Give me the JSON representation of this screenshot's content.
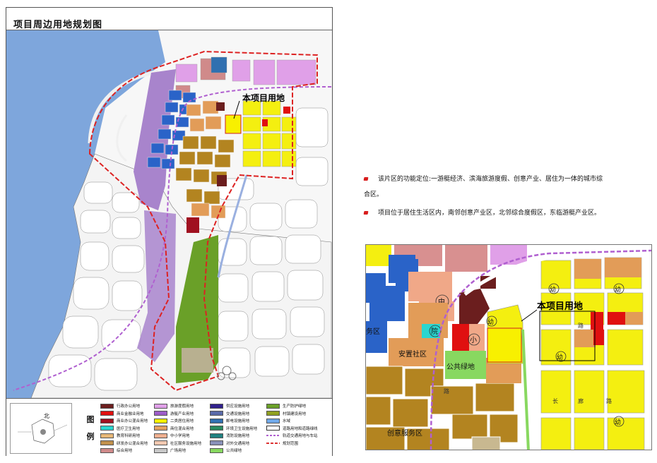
{
  "map_title": "项目周边用地规划图",
  "main_map": {
    "callout": "本项目用地"
  },
  "legend": {
    "heading_chars": [
      "图",
      "例"
    ],
    "north": "北",
    "columns": [
      [
        {
          "label": "行政办公用地",
          "color": "#6b1e1e"
        },
        {
          "label": "商业金融业用地",
          "color": "#e01010"
        },
        {
          "label": "商业办公混合用地",
          "color": "#a01020"
        },
        {
          "label": "医疗卫生用地",
          "color": "#2ad6d0"
        },
        {
          "label": "教育科研用地",
          "color": "#e8b878"
        },
        {
          "label": "研发办公混合用地",
          "color": "#c0904c"
        },
        {
          "label": "综合用地",
          "color": "#d08a8a"
        }
      ],
      [
        {
          "label": "旅游度假用地",
          "color": "#e0a0e8"
        },
        {
          "label": "游艇产业用地",
          "color": "#9c5cc8"
        },
        {
          "label": "二类居住用地",
          "color": "#f4f000"
        },
        {
          "label": "商住混合用地",
          "color": "#e2a060"
        },
        {
          "label": "中小学用地",
          "color": "#f0b090"
        },
        {
          "label": "社区服务设施用地",
          "color": "#f2c8b0"
        },
        {
          "label": "广场用地",
          "color": "#c8c8c8"
        }
      ],
      [
        {
          "label": "供应设施用地",
          "color": "#30208c"
        },
        {
          "label": "交通设施用地",
          "color": "#5a6aa8"
        },
        {
          "label": "邮电设施用地",
          "color": "#3070b0"
        },
        {
          "label": "环境卫生设施用地",
          "color": "#2a8a60"
        },
        {
          "label": "消防设施用地",
          "color": "#208080"
        },
        {
          "label": "对外交通用地",
          "color": "#8890b8"
        },
        {
          "label": "公共绿地",
          "color": "#88d860"
        }
      ],
      [
        {
          "label": "生产防护绿地",
          "color": "#6aa028"
        },
        {
          "label": "村镇建设用地",
          "color": "#90a020"
        },
        {
          "label": "水域",
          "color": "#6fa8e8"
        },
        {
          "label": "道路用地和道路绿线",
          "color": "#ffffff"
        },
        {
          "label": "轨道交通用地与车站",
          "color": "#b060d0"
        },
        {
          "label": "规划范围",
          "color": "#dd2222"
        }
      ]
    ]
  },
  "paragraphs": [
    "该片区的功能定位:一游艇经济、滨海旅游度假、创意产业、居住为一体的城市综合区。",
    "项目位于居住生活区内，南邻创意产业区，北邻综合度假区，东临游艇产业区。"
  ],
  "inset_map": {
    "callout": "本项目用地",
    "labels": {
      "school_mid": "中",
      "school_small": "小",
      "hospital": "院",
      "anzhi": "安置社区",
      "green": "公共绿地",
      "service_left": "务区",
      "chuangyi": "创意服务区",
      "kindergarten": "幼",
      "road_chars": [
        "路",
        "路",
        "长",
        "廊",
        "路"
      ]
    }
  }
}
